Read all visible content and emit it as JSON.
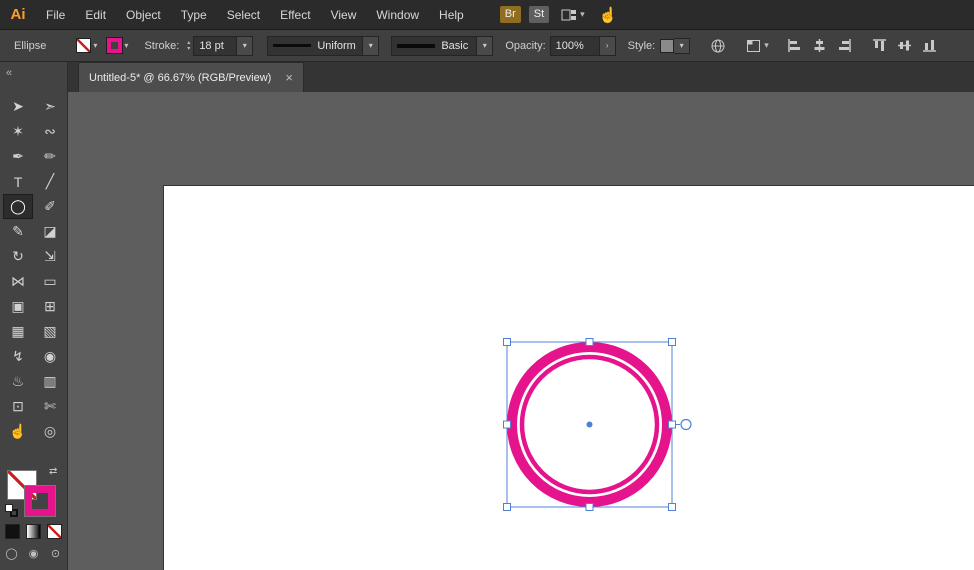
{
  "menubar": {
    "logo": "Ai",
    "items": [
      "File",
      "Edit",
      "Object",
      "Type",
      "Select",
      "Effect",
      "View",
      "Window",
      "Help"
    ],
    "br_label": "Br",
    "st_label": "St"
  },
  "control": {
    "tool_label": "Ellipse",
    "stroke_label": "Stroke:",
    "stroke_weight": "18 pt",
    "variable_width": "Uniform",
    "brush": "Basic",
    "opacity_label": "Opacity:",
    "opacity_value": "100%",
    "style_label": "Style:"
  },
  "tab": {
    "title": "Untitled-5* @ 66.67% (RGB/Preview)",
    "close": "×"
  },
  "toolbar": {
    "collapse": "«",
    "tools": [
      {
        "name": "selection",
        "glyph": "➤"
      },
      {
        "name": "direct-selection",
        "glyph": "➣"
      },
      {
        "name": "magic-wand",
        "glyph": "✶"
      },
      {
        "name": "lasso",
        "glyph": "∾"
      },
      {
        "name": "pen",
        "glyph": "✒"
      },
      {
        "name": "curvature",
        "glyph": "✏"
      },
      {
        "name": "type",
        "glyph": "T"
      },
      {
        "name": "line-segment",
        "glyph": "╱"
      },
      {
        "name": "ellipse",
        "glyph": "◯"
      },
      {
        "name": "paintbrush",
        "glyph": "✐"
      },
      {
        "name": "pencil",
        "glyph": "✎"
      },
      {
        "name": "eraser",
        "glyph": "◪"
      },
      {
        "name": "rotate",
        "glyph": "↻"
      },
      {
        "name": "scale",
        "glyph": "⇲"
      },
      {
        "name": "width",
        "glyph": "⋈"
      },
      {
        "name": "free-transform",
        "glyph": "▭"
      },
      {
        "name": "shape-builder",
        "glyph": "▣"
      },
      {
        "name": "perspective-grid",
        "glyph": "⊞"
      },
      {
        "name": "mesh",
        "glyph": "▦"
      },
      {
        "name": "gradient",
        "glyph": "▧"
      },
      {
        "name": "eyedropper",
        "glyph": "↯"
      },
      {
        "name": "blend",
        "glyph": "◉"
      },
      {
        "name": "symbol-sprayer",
        "glyph": "♨"
      },
      {
        "name": "column-graph",
        "glyph": "▥"
      },
      {
        "name": "artboard",
        "glyph": "⊡"
      },
      {
        "name": "slice",
        "glyph": "✄"
      },
      {
        "name": "hand",
        "glyph": "☝"
      },
      {
        "name": "zoom",
        "glyph": "◎"
      }
    ]
  },
  "icons": {
    "swap": "⇄",
    "chevron_down": "▾",
    "chevron_right": "›",
    "stepper_up": "▴",
    "stepper_down": "▾",
    "draw_normal": "◯",
    "draw_behind": "◉",
    "draw_inside": "⊙",
    "hand_menu": "☝"
  },
  "colors": {
    "pink": "#e5148c",
    "selection_blue": "#4f80d9",
    "none_slash_red": "#cc1f1f"
  },
  "canvas": {
    "shape": {
      "type": "ellipse",
      "fill": "none",
      "stroke": "#e5148c"
    }
  }
}
